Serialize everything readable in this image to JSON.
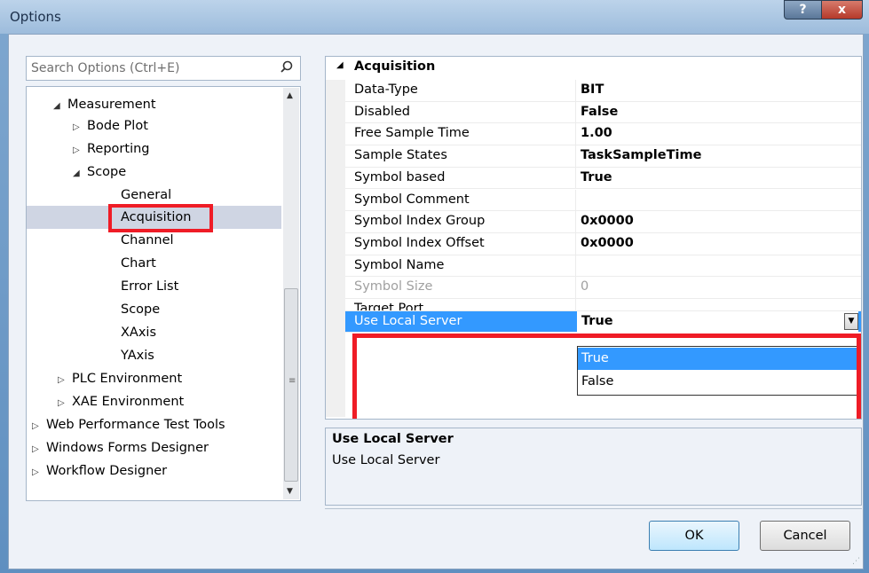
{
  "window": {
    "title": "Options",
    "help_btn": "?",
    "close_btn": "x"
  },
  "search": {
    "placeholder": "Search Options (Ctrl+E)"
  },
  "tree": {
    "items": [
      {
        "label": "Measurement",
        "arrow": "◢"
      },
      {
        "label": "Bode Plot",
        "arrow": "▷"
      },
      {
        "label": "Reporting",
        "arrow": "▷"
      },
      {
        "label": "Scope",
        "arrow": "◢"
      },
      {
        "label": "General"
      },
      {
        "label": "Acquisition"
      },
      {
        "label": "Channel"
      },
      {
        "label": "Chart"
      },
      {
        "label": "Error List"
      },
      {
        "label": "Scope"
      },
      {
        "label": "XAxis"
      },
      {
        "label": "YAxis"
      },
      {
        "label": "PLC Environment",
        "arrow": "▷"
      },
      {
        "label": "XAE Environment",
        "arrow": "▷"
      },
      {
        "label": "Web Performance Test Tools",
        "arrow": "▷"
      },
      {
        "label": "Windows Forms Designer",
        "arrow": "▷"
      },
      {
        "label": "Workflow Designer",
        "arrow": "▷"
      }
    ],
    "selected": "Acquisition"
  },
  "grid": {
    "category": "Acquisition",
    "category_arrow": "◢",
    "rows": [
      {
        "key": "Data-Type",
        "value": "BIT"
      },
      {
        "key": "Disabled",
        "value": "False"
      },
      {
        "key": "Free Sample Time",
        "value": "1.00"
      },
      {
        "key": "Sample States",
        "value": "TaskSampleTime"
      },
      {
        "key": "Symbol based",
        "value": "True"
      },
      {
        "key": "Symbol Comment",
        "value": ""
      },
      {
        "key": "Symbol Index Group",
        "value": "0x0000"
      },
      {
        "key": "Symbol Index Offset",
        "value": "0x0000"
      },
      {
        "key": "Symbol Name",
        "value": ""
      },
      {
        "key": "Symbol Size",
        "value": "0"
      },
      {
        "key": "Target Port",
        "value": ""
      },
      {
        "key": "Use Local Server",
        "value": "True"
      }
    ],
    "dropdown_options": [
      "True",
      "False"
    ],
    "dropdown_highlighted": "True"
  },
  "description": {
    "title": "Use Local Server",
    "text": "Use Local Server"
  },
  "buttons": {
    "ok": "OK",
    "cancel": "Cancel"
  },
  "colors": {
    "selection": "#3399ff",
    "highlight_box": "#ef1c26",
    "tree_selected": "#cfd5e3"
  }
}
